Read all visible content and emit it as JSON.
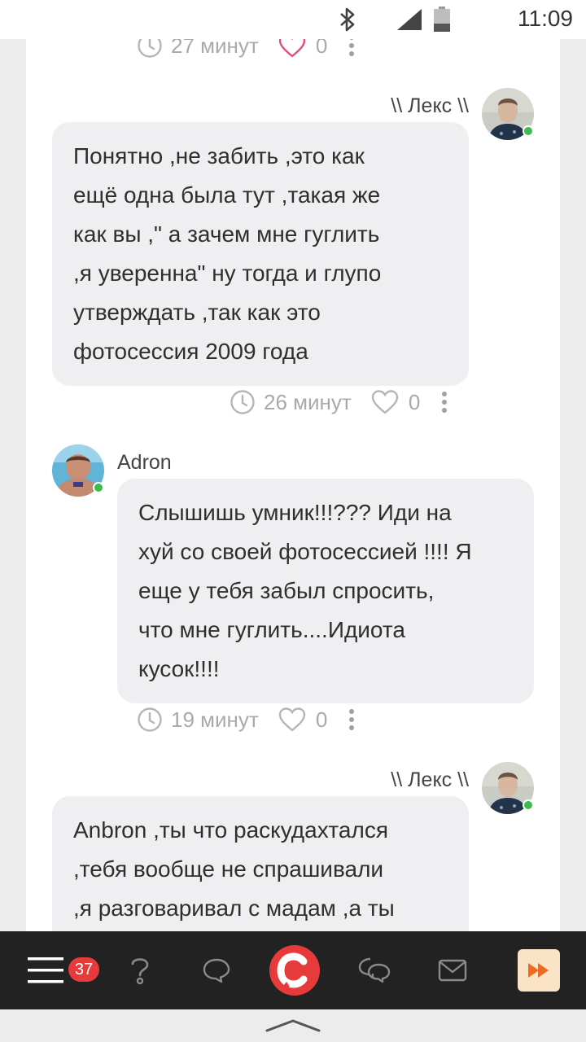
{
  "status_bar": {
    "time": "11:09"
  },
  "messages": [
    {
      "time": "27 минут",
      "likes": "0",
      "liked": true
    },
    {
      "author": "\\\\ Лекс \\\\",
      "lines": [
        "Понятно ,не забить ,это как",
        "ещё одна была тут ,такая же",
        "как вы ,\" а зачем мне гуглить",
        ",я уверенна\" ну тогда и глупо",
        "утверждать ,так как это",
        "фотосессия 2009 года"
      ],
      "time": "26 минут",
      "likes": "0"
    },
    {
      "author": "Adron",
      "lines": [
        "Слышишь умник!!!??? Иди на",
        "хуй со своей фотосессией !!!! Я",
        "еще у тебя забыл спросить,",
        "что мне гуглить....Идиота",
        "кусок!!!!"
      ],
      "time": "19 минут",
      "likes": "0"
    },
    {
      "author": "\\\\ Лекс \\\\",
      "lines": [
        "Anbron ,ты что раскудахтался",
        ",тебя вообще не спрашивали",
        ",я разговаривал с мадам ,а ты"
      ]
    }
  ],
  "bottom_nav": {
    "badge_count": "37",
    "items": [
      "menu-icon",
      "help-icon",
      "chat-icon",
      "app-logo",
      "messages-icon",
      "mail-icon",
      "fast-forward-icon"
    ]
  },
  "colors": {
    "accent_red": "#e73b3b",
    "online_green": "#3cbc4d",
    "ff_button": "#fbe3c8"
  }
}
